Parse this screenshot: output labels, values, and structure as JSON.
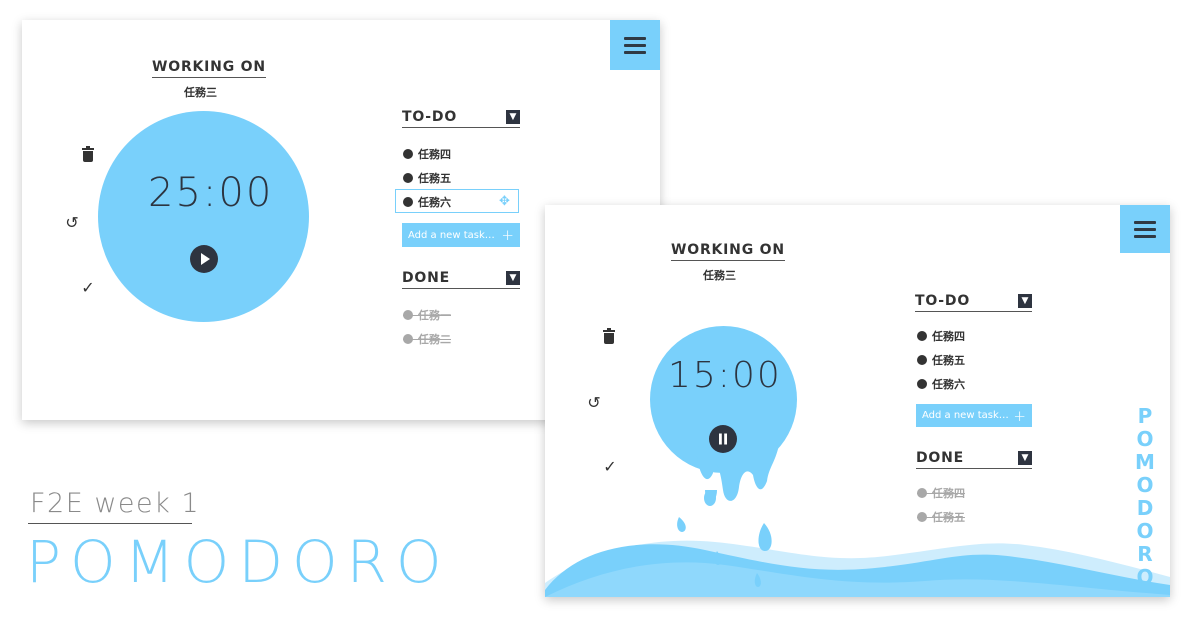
{
  "footer": {
    "subtitle": "F2E week 1",
    "title": "POMODORO"
  },
  "colors": {
    "accent": "#79d0fb",
    "dark": "#2e3440",
    "done_text": "#a8a8a8"
  },
  "screen_1": {
    "working_on_label": "WORKING ON",
    "current_task": "任務三",
    "timer": "25:00",
    "play_icon": "play-icon",
    "todo_label": "TO-DO",
    "todo_items": [
      "任務四",
      "任務五",
      "任務六"
    ],
    "editing_item_index": 2,
    "add_placeholder": "Add a new task…",
    "done_label": "DONE",
    "done_items": [
      "任務一",
      "任務二"
    ]
  },
  "screen_2": {
    "working_on_label": "WORKING ON",
    "current_task": "任務三",
    "timer": "15:00",
    "pause_icon": "pause-icon",
    "todo_label": "TO-DO",
    "todo_items": [
      "任務四",
      "任務五",
      "任務六"
    ],
    "add_placeholder": "Add a new task…",
    "done_label": "DONE",
    "done_items": [
      "任務四",
      "任務五"
    ],
    "brand_vertical": [
      "P",
      "O",
      "M",
      "O",
      "D",
      "O",
      "R",
      "O"
    ]
  }
}
